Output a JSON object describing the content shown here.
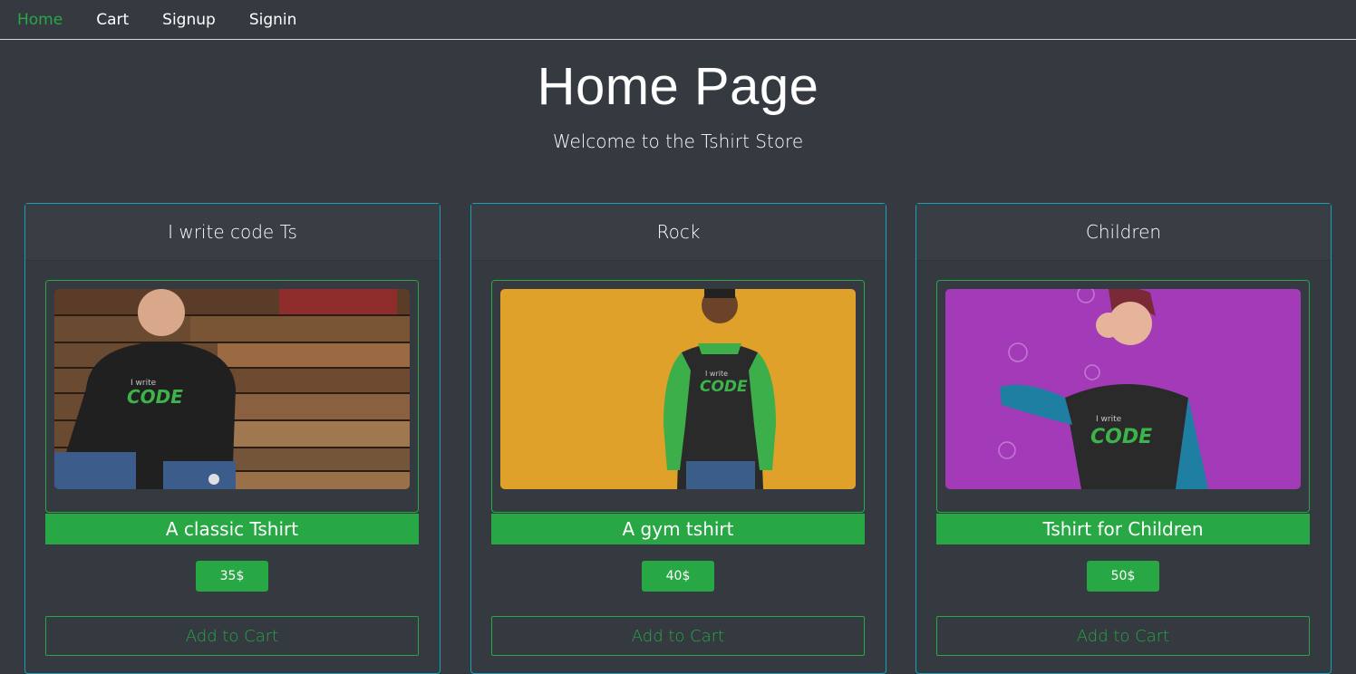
{
  "nav": {
    "items": [
      {
        "label": "Home",
        "active": true
      },
      {
        "label": "Cart",
        "active": false
      },
      {
        "label": "Signup",
        "active": false
      },
      {
        "label": "Signin",
        "active": false
      }
    ]
  },
  "header": {
    "title": "Home Page",
    "subtitle": "Welcome to the Tshirt Store"
  },
  "products": [
    {
      "category": "I write code Ts",
      "name": "A classic Tshirt",
      "price": "35$",
      "button": "Add to Cart"
    },
    {
      "category": "Rock",
      "name": "A gym tshirt",
      "price": "40$",
      "button": "Add to Cart"
    },
    {
      "category": "Children",
      "name": "Tshirt for Children",
      "price": "50$",
      "button": "Add to Cart"
    }
  ],
  "colors": {
    "background": "#343a40",
    "accent": "#28a745",
    "card_border": "#17a2b8"
  }
}
